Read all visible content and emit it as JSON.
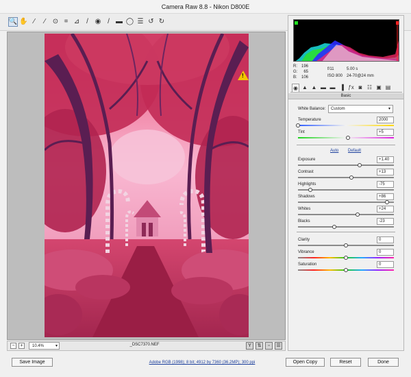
{
  "window": {
    "title": "Camera Raw 8.8  -  Nikon D800E"
  },
  "toolbar": {
    "tools": [
      {
        "name": "zoom-tool",
        "icon": "magnifier-icon",
        "glyph": "🔍",
        "active": true
      },
      {
        "name": "hand-tool",
        "icon": "hand-icon",
        "glyph": "✋"
      },
      {
        "name": "white-balance-tool",
        "icon": "eyedropper-icon",
        "glyph": "⁄"
      },
      {
        "name": "color-sampler-tool",
        "icon": "color-sampler-icon",
        "glyph": "⁄"
      },
      {
        "name": "targeted-adjustment-tool",
        "icon": "target-icon",
        "glyph": "⊙"
      },
      {
        "name": "crop-tool",
        "icon": "crop-icon",
        "glyph": "⌗"
      },
      {
        "name": "straighten-tool",
        "icon": "level-icon",
        "glyph": "⊿"
      },
      {
        "name": "spot-removal-tool",
        "icon": "brush-icon",
        "glyph": "/"
      },
      {
        "name": "red-eye-tool",
        "icon": "eye-icon",
        "glyph": "◉"
      },
      {
        "name": "adjustment-brush-tool",
        "icon": "adjustment-brush-icon",
        "glyph": "/"
      },
      {
        "name": "graduated-filter-tool",
        "icon": "graduated-filter-icon",
        "glyph": "▬"
      },
      {
        "name": "radial-filter-tool",
        "icon": "radial-filter-icon",
        "glyph": "◯"
      },
      {
        "name": "preferences-tool",
        "icon": "list-icon",
        "glyph": "☰"
      },
      {
        "name": "rotate-left-tool",
        "icon": "rotate-ccw-icon",
        "glyph": "↺"
      },
      {
        "name": "rotate-right-tool",
        "icon": "rotate-cw-icon",
        "glyph": "↻"
      }
    ],
    "export_glyph": "⇥"
  },
  "preview": {
    "warning_glyph": "!",
    "colors": {
      "sky": "#f9b7d1",
      "foliage": "#c0264f",
      "trunk": "#5a1e52",
      "path": "#9a1e45",
      "ground": "#b9365a"
    }
  },
  "status": {
    "zoom_minus": "−",
    "zoom_plus": "+",
    "zoom_value": "10.4%",
    "zoom_arrow": "▾",
    "filename": "_DSC7370.NEF"
  },
  "histogram": {
    "readout": {
      "r_label": "R:",
      "r_value": "196",
      "g_label": "G:",
      "g_value": "65",
      "b_label": "B:",
      "b_value": "106"
    },
    "camera": {
      "aperture": "f/11",
      "shutter": "5.00 s",
      "iso": "ISO 800",
      "lens": "24-70@24 mm"
    }
  },
  "panel": {
    "title": "Basic",
    "tab_glyphs": [
      "◉",
      "▲",
      "▲",
      "▬",
      "▬",
      "▐",
      "ƒx",
      "◙",
      "☷",
      "▣",
      "▤"
    ],
    "white_balance": {
      "label": "White Balance:",
      "value": "Custom",
      "arrow": "▾"
    },
    "auto_label": "Auto",
    "default_label": "Default",
    "sliders": [
      {
        "id": "temperature",
        "label": "Temperature",
        "value": "2000",
        "pos": 0.0,
        "track": "temp"
      },
      {
        "id": "tint",
        "label": "Tint",
        "value": "+5",
        "pos": 0.52,
        "track": "tint"
      },
      {
        "id": "exposure",
        "label": "Exposure",
        "value": "+1.40",
        "pos": 0.64,
        "track": "plain"
      },
      {
        "id": "contrast",
        "label": "Contrast",
        "value": "+13",
        "pos": 0.56,
        "track": "plain"
      },
      {
        "id": "highlights",
        "label": "Highlights",
        "value": "-75",
        "pos": 0.13,
        "track": "plain"
      },
      {
        "id": "shadows",
        "label": "Shadows",
        "value": "+86",
        "pos": 0.93,
        "track": "plain"
      },
      {
        "id": "whites",
        "label": "Whites",
        "value": "+24",
        "pos": 0.62,
        "track": "plain"
      },
      {
        "id": "blacks",
        "label": "Blacks",
        "value": "-23",
        "pos": 0.38,
        "track": "plain"
      },
      {
        "id": "clarity",
        "label": "Clarity",
        "value": "0",
        "pos": 0.5,
        "track": "plain"
      },
      {
        "id": "vibrance",
        "label": "Vibrance",
        "value": "0",
        "pos": 0.5,
        "track": "sat"
      },
      {
        "id": "saturation",
        "label": "Saturation",
        "value": "0",
        "pos": 0.5,
        "track": "sat"
      }
    ]
  },
  "footer": {
    "save_label": "Save Image",
    "workflow_info": "Adobe RGB (1998); 8 bit; 4912 by 7360 (36.2MP); 300 ppi",
    "open_label": "Open Copy",
    "reset_label": "Reset",
    "done_label": "Done"
  }
}
